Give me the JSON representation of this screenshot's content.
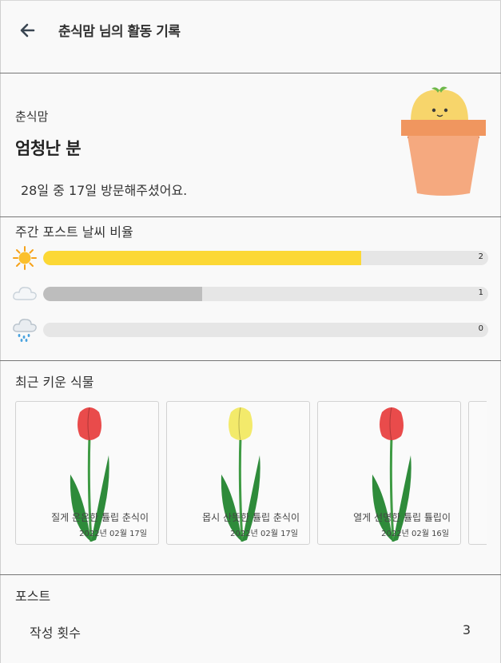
{
  "header": {
    "title": "춘식맘 님의 활동 기록"
  },
  "profile": {
    "nickname": "춘식맘",
    "grade": "엄청난 분",
    "visits_text": "28일 중 17일 방문해주셨어요."
  },
  "weather": {
    "title": "주간 포스트 날씨 비율",
    "rows": [
      {
        "icon": "sun-icon",
        "color": "#fcd835",
        "count": "2",
        "value": 2,
        "max": 2.8
      },
      {
        "icon": "cloud-icon",
        "color": "#bdbdbd",
        "count": "1",
        "value": 1,
        "max": 2.8
      },
      {
        "icon": "rain-cloud-icon",
        "color": "#9e9e9e",
        "count": "0",
        "value": 0,
        "max": 2.8
      }
    ]
  },
  "plants": {
    "title": "최근 키운 식물",
    "items": [
      {
        "name": "질게 은은한 튤립 춘식이",
        "date": "2022년 02월 17일",
        "flower_color": "#e94b4b"
      },
      {
        "name": "몹시 산뜻한 튤립 춘식이",
        "date": "2022년 02월 17일",
        "flower_color": "#f3ea6b"
      },
      {
        "name": "열게 선명한 튤립 튤립이",
        "date": "2022년 02월 16일",
        "flower_color": "#e94b4b"
      }
    ]
  },
  "posts": {
    "title": "포스트",
    "count_label": "작성 횟수",
    "count_value": "3"
  },
  "colors": {
    "divider": "#777777",
    "track": "#e6e6e6",
    "pot": "#f5a97f",
    "pot_rim": "#f0965f",
    "leaf_green": "#2e8b3a",
    "mascot_yellow": "#f7d56b"
  }
}
